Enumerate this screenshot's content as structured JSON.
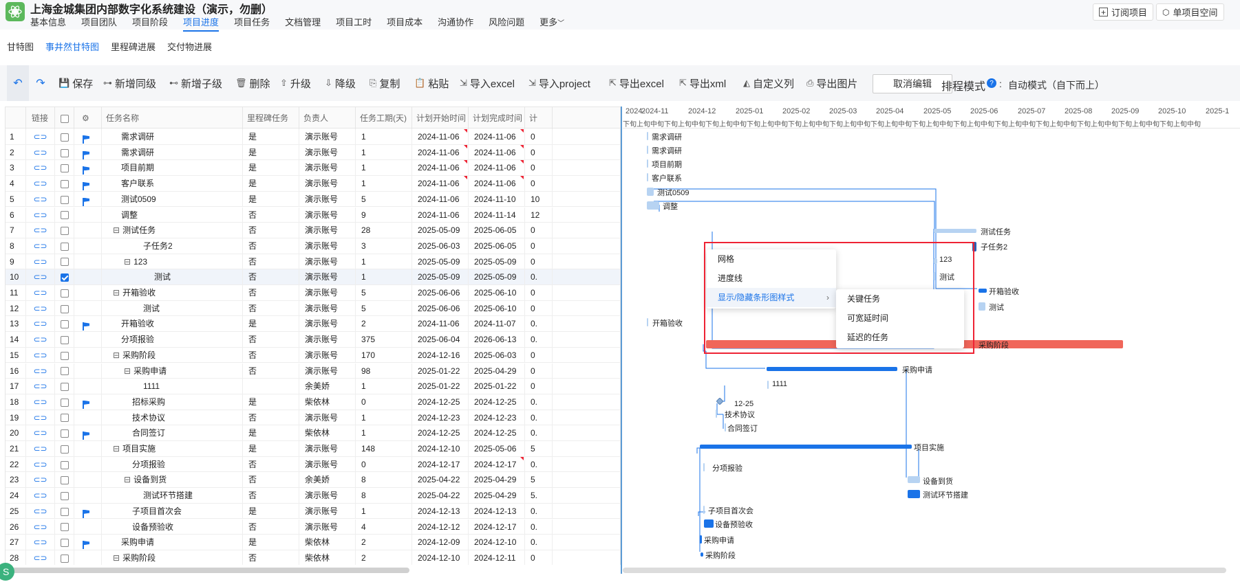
{
  "project": {
    "title": "上海金城集团内部数字化系统建设（演示，勿删）",
    "nav": [
      "基本信息",
      "项目团队",
      "项目阶段",
      "项目进度",
      "项目任务",
      "文档管理",
      "项目工时",
      "项目成本",
      "沟通协作",
      "风险问题",
      "更多"
    ],
    "active_nav": "项目进度",
    "subscribe": "订阅项目",
    "space": "单项目空间"
  },
  "subtabs": {
    "items": [
      "甘特图",
      "事井然甘特图",
      "里程碑进展",
      "交付物进展"
    ],
    "active": "事井然甘特图"
  },
  "toolbar": {
    "save": "保存",
    "add_sibling": "新增同级",
    "add_child": "新增子级",
    "delete": "删除",
    "upgrade": "升级",
    "downgrade": "降级",
    "copy": "复制",
    "paste": "粘贴",
    "import_excel": "导入excel",
    "import_project": "导入project",
    "export_excel": "导出excel",
    "export_xml": "导出xml",
    "custom_columns": "自定义列",
    "export_image": "导出图片",
    "cancel_edit": "取消编辑",
    "schedule_mode_label": "排程模式",
    "schedule_mode_value": "自动模式（自下而上）"
  },
  "grid": {
    "headers": [
      "链接",
      "",
      "",
      "任务名称",
      "里程碑任务",
      "负责人",
      "任务工期(天)",
      "计划开始时间",
      "计划完成时间",
      "计"
    ],
    "rows": [
      {
        "n": "1",
        "chk": false,
        "flag": true,
        "indent": 0,
        "tg": "",
        "name": "需求调研",
        "ms": "是",
        "owner": "演示账号",
        "dur": "1",
        "start": "2024-11-06",
        "end": "2024-11-06",
        "x": "0",
        "t1": true,
        "t2": true,
        "t3": false
      },
      {
        "n": "2",
        "chk": false,
        "flag": true,
        "indent": 0,
        "tg": "",
        "name": "需求调研",
        "ms": "是",
        "owner": "演示账号",
        "dur": "1",
        "start": "2024-11-06",
        "end": "2024-11-06",
        "x": "0",
        "t1": true,
        "t2": true,
        "t3": false
      },
      {
        "n": "3",
        "chk": false,
        "flag": true,
        "indent": 0,
        "tg": "",
        "name": "项目前期",
        "ms": "是",
        "owner": "演示账号",
        "dur": "1",
        "start": "2024-11-06",
        "end": "2024-11-06",
        "x": "0",
        "t1": true,
        "t2": true,
        "t3": false
      },
      {
        "n": "4",
        "chk": false,
        "flag": true,
        "indent": 0,
        "tg": "",
        "name": "客户联系",
        "ms": "是",
        "owner": "演示账号",
        "dur": "1",
        "start": "2024-11-06",
        "end": "2024-11-06",
        "x": "0",
        "t1": true,
        "t2": true,
        "t3": false
      },
      {
        "n": "5",
        "chk": false,
        "flag": true,
        "indent": 0,
        "tg": "",
        "name": "测试0509",
        "ms": "是",
        "owner": "演示账号",
        "dur": "5",
        "start": "2024-11-06",
        "end": "2024-11-10",
        "x": "10",
        "t1": false,
        "t2": false,
        "t3": false
      },
      {
        "n": "6",
        "chk": false,
        "flag": false,
        "indent": 0,
        "tg": "",
        "name": "调整",
        "ms": "否",
        "owner": "演示账号",
        "dur": "9",
        "start": "2024-11-06",
        "end": "2024-11-14",
        "x": "12",
        "t1": false,
        "t2": false,
        "t3": false
      },
      {
        "n": "7",
        "chk": false,
        "flag": false,
        "indent": 0,
        "tg": "⊟",
        "name": "测试任务",
        "ms": "否",
        "owner": "演示账号",
        "dur": "28",
        "start": "2025-05-09",
        "end": "2025-06-05",
        "x": "0",
        "t1": false,
        "t2": false,
        "t3": false
      },
      {
        "n": "8",
        "chk": false,
        "flag": false,
        "indent": 2,
        "tg": "",
        "name": "子任务2",
        "ms": "否",
        "owner": "演示账号",
        "dur": "3",
        "start": "2025-06-03",
        "end": "2025-06-05",
        "x": "0",
        "t1": false,
        "t2": false,
        "t3": false
      },
      {
        "n": "9",
        "chk": false,
        "flag": false,
        "indent": 1,
        "tg": "⊟",
        "name": "123",
        "ms": "否",
        "owner": "演示账号",
        "dur": "1",
        "start": "2025-05-09",
        "end": "2025-05-09",
        "x": "0",
        "t1": false,
        "t2": false,
        "t3": false
      },
      {
        "n": "10",
        "chk": true,
        "flag": false,
        "indent": 3,
        "tg": "",
        "name": "测试",
        "ms": "否",
        "owner": "演示账号",
        "dur": "1",
        "start": "2025-05-09",
        "end": "2025-05-09",
        "x": "0.",
        "t1": false,
        "t2": false,
        "t3": false
      },
      {
        "n": "11",
        "chk": false,
        "flag": false,
        "indent": 0,
        "tg": "⊟",
        "name": "开箱验收",
        "ms": "否",
        "owner": "演示账号",
        "dur": "5",
        "start": "2025-06-06",
        "end": "2025-06-10",
        "x": "0",
        "t1": false,
        "t2": false,
        "t3": false
      },
      {
        "n": "12",
        "chk": false,
        "flag": false,
        "indent": 2,
        "tg": "",
        "name": "测试",
        "ms": "否",
        "owner": "演示账号",
        "dur": "5",
        "start": "2025-06-06",
        "end": "2025-06-10",
        "x": "0",
        "t1": false,
        "t2": false,
        "t3": false
      },
      {
        "n": "13",
        "chk": false,
        "flag": true,
        "indent": 0,
        "tg": "",
        "name": "开箱验收",
        "ms": "是",
        "owner": "演示账号",
        "dur": "2",
        "start": "2024-11-06",
        "end": "2024-11-07",
        "x": "0.",
        "t1": false,
        "t2": false,
        "t3": false
      },
      {
        "n": "14",
        "chk": false,
        "flag": false,
        "indent": 0,
        "tg": "",
        "name": "分项报验",
        "ms": "否",
        "owner": "演示账号",
        "dur": "375",
        "start": "2025-06-04",
        "end": "2026-06-13",
        "x": "0.",
        "t1": false,
        "t2": false,
        "t3": false
      },
      {
        "n": "15",
        "chk": false,
        "flag": false,
        "indent": 0,
        "tg": "⊟",
        "name": "采购阶段",
        "ms": "否",
        "owner": "演示账号",
        "dur": "170",
        "start": "2024-12-16",
        "end": "2025-06-03",
        "x": "0",
        "t1": false,
        "t2": false,
        "t3": false
      },
      {
        "n": "16",
        "chk": false,
        "flag": false,
        "indent": 1,
        "tg": "⊟",
        "name": "采购申请",
        "ms": "否",
        "owner": "演示账号",
        "dur": "98",
        "start": "2025-01-22",
        "end": "2025-04-29",
        "x": "0",
        "t1": false,
        "t2": false,
        "t3": false
      },
      {
        "n": "17",
        "chk": false,
        "flag": false,
        "indent": 2,
        "tg": "",
        "name": "1111",
        "ms": "",
        "owner": "余美娇",
        "dur": "1",
        "start": "2025-01-22",
        "end": "2025-01-22",
        "x": "0",
        "t1": false,
        "t2": false,
        "t3": false
      },
      {
        "n": "18",
        "chk": false,
        "flag": true,
        "indent": 1,
        "tg": "",
        "name": "招标采购",
        "ms": "是",
        "owner": "柴依林",
        "dur": "0",
        "start": "2024-12-25",
        "end": "2024-12-25",
        "x": "0.",
        "t1": false,
        "t2": false,
        "t3": false
      },
      {
        "n": "19",
        "chk": false,
        "flag": false,
        "indent": 1,
        "tg": "",
        "name": "技术协议",
        "ms": "否",
        "owner": "演示账号",
        "dur": "1",
        "start": "2024-12-23",
        "end": "2024-12-23",
        "x": "0.",
        "t1": false,
        "t2": false,
        "t3": false
      },
      {
        "n": "20",
        "chk": false,
        "flag": true,
        "indent": 1,
        "tg": "",
        "name": "合同签订",
        "ms": "是",
        "owner": "柴依林",
        "dur": "1",
        "start": "2024-12-25",
        "end": "2024-12-25",
        "x": "0.",
        "t1": false,
        "t2": false,
        "t3": false
      },
      {
        "n": "21",
        "chk": false,
        "flag": false,
        "indent": 0,
        "tg": "⊟",
        "name": "项目实施",
        "ms": "是",
        "owner": "演示账号",
        "dur": "148",
        "start": "2024-12-10",
        "end": "2025-05-06",
        "x": "5",
        "t1": false,
        "t2": false,
        "t3": false
      },
      {
        "n": "22",
        "chk": false,
        "flag": false,
        "indent": 1,
        "tg": "",
        "name": "分项报验",
        "ms": "否",
        "owner": "演示账号",
        "dur": "0",
        "start": "2024-12-17",
        "end": "2024-12-17",
        "x": "0.",
        "t1": false,
        "t2": true,
        "t3": true
      },
      {
        "n": "23",
        "chk": false,
        "flag": false,
        "indent": 1,
        "tg": "⊟",
        "name": "设备到货",
        "ms": "否",
        "owner": "余美娇",
        "dur": "8",
        "start": "2025-04-22",
        "end": "2025-04-29",
        "x": "5",
        "t1": false,
        "t2": false,
        "t3": false
      },
      {
        "n": "24",
        "chk": false,
        "flag": false,
        "indent": 2,
        "tg": "",
        "name": "测试环节搭建",
        "ms": "否",
        "owner": "演示账号",
        "dur": "8",
        "start": "2025-04-22",
        "end": "2025-04-29",
        "x": "5.",
        "t1": false,
        "t2": false,
        "t3": false
      },
      {
        "n": "25",
        "chk": false,
        "flag": true,
        "indent": 1,
        "tg": "",
        "name": "子项目首次会",
        "ms": "是",
        "owner": "演示账号",
        "dur": "1",
        "start": "2024-12-13",
        "end": "2024-12-13",
        "x": "0.",
        "t1": false,
        "t2": false,
        "t3": false
      },
      {
        "n": "26",
        "chk": false,
        "flag": false,
        "indent": 1,
        "tg": "",
        "name": "设备预验收",
        "ms": "否",
        "owner": "演示账号",
        "dur": "4",
        "start": "2024-12-12",
        "end": "2024-12-17",
        "x": "0.",
        "t1": false,
        "t2": false,
        "t3": false
      },
      {
        "n": "27",
        "chk": false,
        "flag": true,
        "indent": 0,
        "tg": "",
        "name": "采购申请",
        "ms": "是",
        "owner": "柴依林",
        "dur": "2",
        "start": "2024-12-09",
        "end": "2024-12-10",
        "x": "0.",
        "t1": false,
        "t2": false,
        "t3": false
      },
      {
        "n": "28",
        "chk": false,
        "flag": false,
        "indent": 0,
        "tg": "⊟",
        "name": "采购阶段",
        "ms": "否",
        "owner": "柴依林",
        "dur": "2",
        "start": "2024-12-10",
        "end": "2024-12-11",
        "x": "0",
        "t1": false,
        "t2": false,
        "t3": false
      }
    ]
  },
  "gantt": {
    "months": [
      "2024-",
      "2024-11",
      "2024-12",
      "2025-01",
      "2025-02",
      "2025-03",
      "2025-04",
      "2025-05",
      "2025-06",
      "2025-07",
      "2025-08",
      "2025-09",
      "2025-10",
      "2025-1"
    ],
    "dekads": "下旬上旬中旬下旬上旬中旬下旬上旬中旬下旬上旬中旬下旬上旬中旬下旬上旬中旬下旬上旬中旬下旬上旬中旬下旬上旬中旬下旬上旬中旬下旬上旬中旬下旬上旬中旬下旬上旬中旬下旬上旬中旬",
    "bar_labels": [
      "需求调研",
      "需求调研",
      "项目前期",
      "客户联系",
      "测试0509",
      "调整",
      "测试任务",
      "子任务2",
      "123",
      "测试",
      "开箱验收",
      "测试",
      "开箱验收",
      "采购阶段",
      "采购申请",
      "1111",
      "12-25",
      "技术协议",
      "合同签订",
      "项目实施",
      "分项报验",
      "设备到货",
      "测试环节搭建",
      "子项目首次会",
      "设备预验收",
      "采购申请",
      "采购阶段"
    ]
  },
  "context_menu": {
    "items": [
      "网格",
      "进度线",
      "显示/隐藏条形图样式"
    ],
    "submenu": [
      "关键任务",
      "可宽延时间",
      "延迟的任务"
    ]
  },
  "colors": {
    "accent": "#1a73e8",
    "bar_light": "#b7d3f2",
    "bar_dark": "#1a73e8",
    "critical": "#f0665a",
    "highlight_box": "#e23"
  }
}
